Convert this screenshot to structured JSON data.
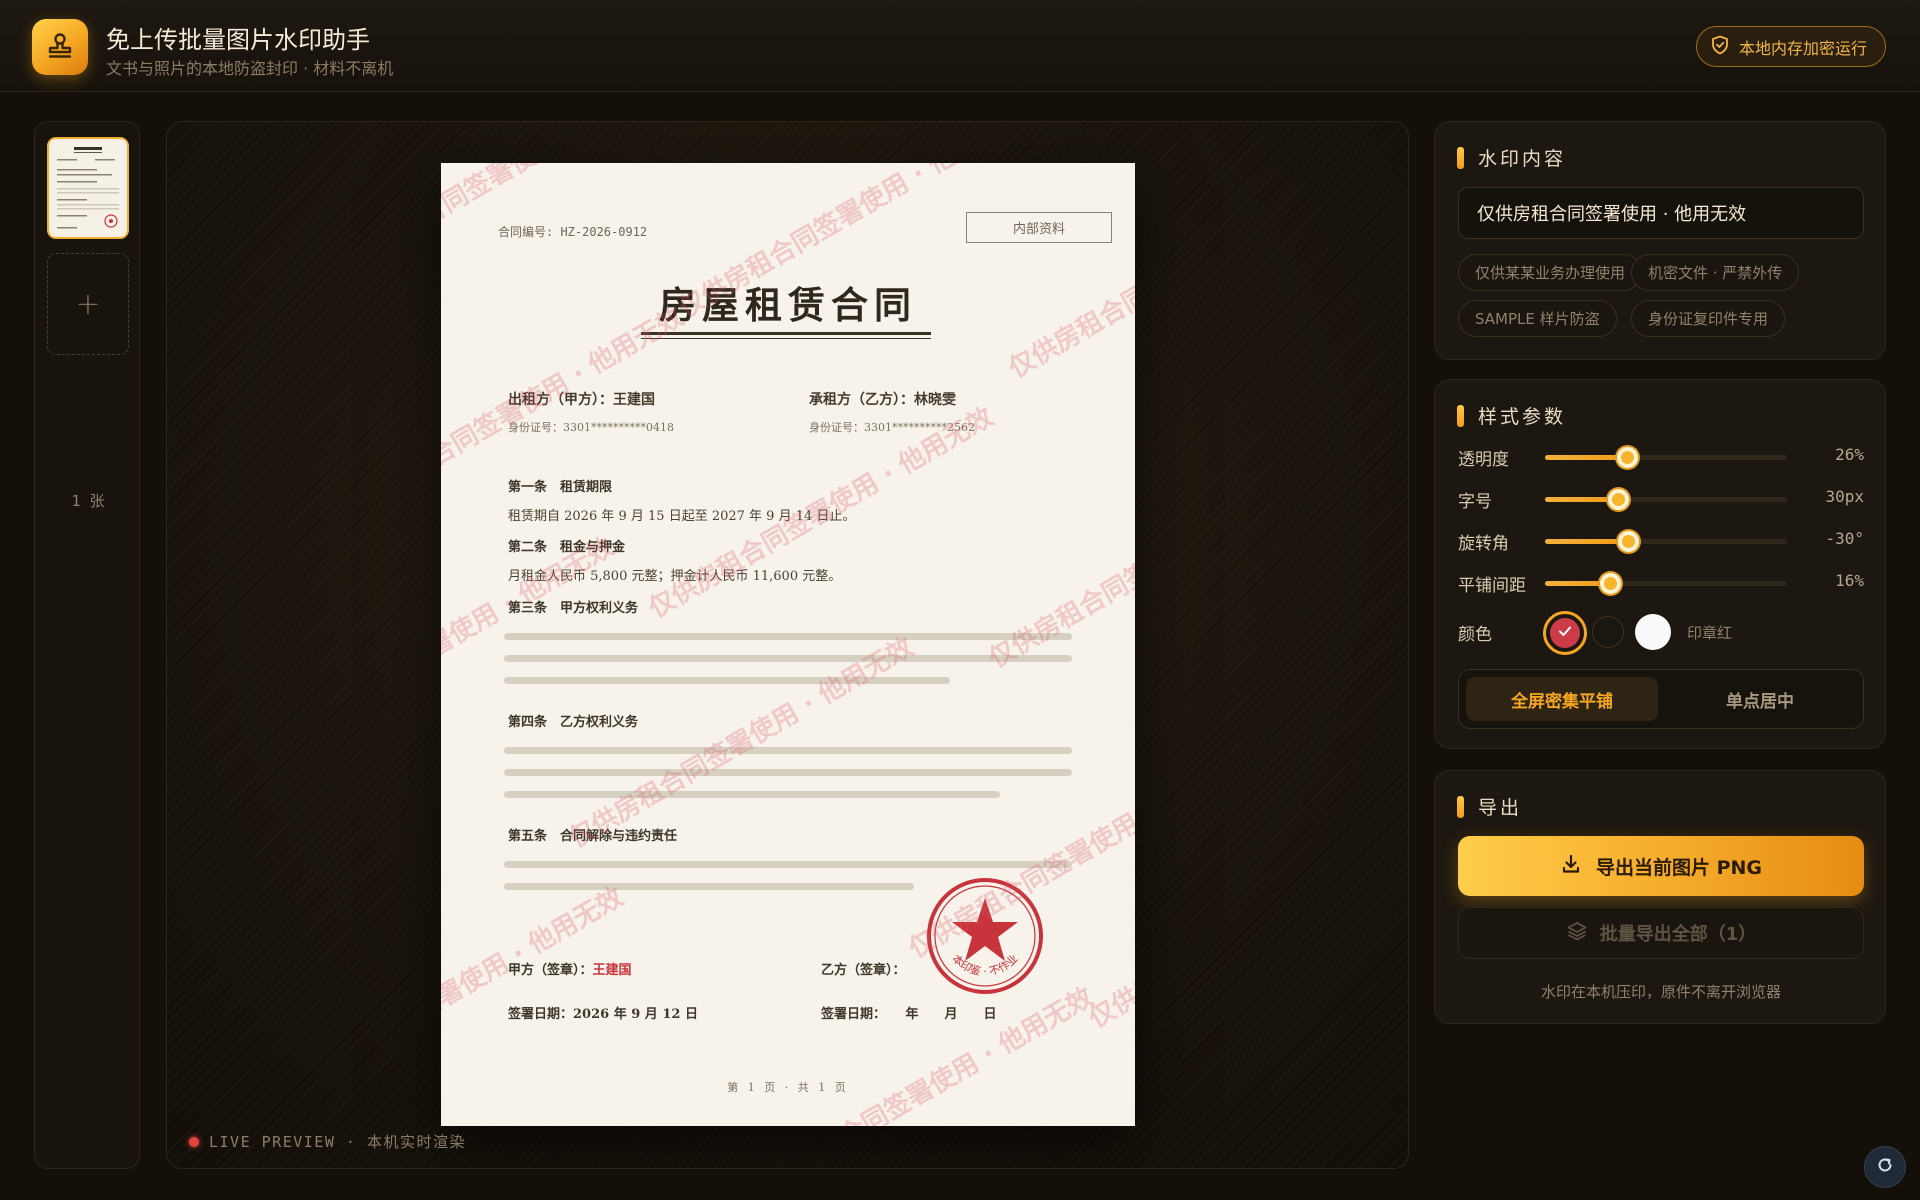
{
  "header": {
    "title": "免上传批量图片水印助手",
    "subtitle": "文书与照片的本地防盗封印 · 材料不离机",
    "badge": "本地内存加密运行"
  },
  "thumbnails": {
    "count_label": "1 张",
    "add_label": "+"
  },
  "preview": {
    "live_label": "LIVE PREVIEW · 本机实时渲染",
    "document": {
      "contract_no": "合同编号: HZ-2026-0912",
      "internal_tag": "内部资料",
      "title": "房屋租赁合同",
      "lessor": "出租方（甲方）：王建国",
      "lessor_id": "身份证号：3301**********0418",
      "lessee": "承租方（乙方）：林晓雯",
      "lessee_id": "身份证号：3301**********2562",
      "art1_title": "第一条　租赁期限",
      "art1_text": "租赁期自 2026 年 9 月 15 日起至 2027 年 9 月 14 日止。",
      "art2_title": "第二条　租金与押金",
      "art2_text": "月租金人民币 5,800 元整；押金计人民币 11,600 元整。",
      "art3_title": "第三条　甲方权利义务",
      "art4_title": "第四条　乙方权利义务",
      "art5_title": "第五条　合同解除与违约责任",
      "sign_a_label": "甲方（签章）：",
      "sign_a_name": "王建国",
      "sign_b_label": "乙方（签章）：",
      "date_a": "签署日期：2026 年 9 月 12 日",
      "date_b": "签署日期：　　年　　月　　日",
      "stamp_text": "本印鉴 · 不作业",
      "page_no": "第 1 页 · 共 1 页",
      "watermark_text": "仅供房租合同签署使用 · 他用无效"
    }
  },
  "content_panel": {
    "title": "水印内容",
    "input_value": "仅供房租合同签署使用 · 他用无效",
    "presets": [
      "仅供某某业务办理使用",
      "机密文件 · 严禁外传",
      "SAMPLE 样片防盗",
      "身份证复印件专用"
    ]
  },
  "style_panel": {
    "title": "样式参数",
    "sliders": [
      {
        "label": "透明度",
        "value": "26%",
        "level": 0.34
      },
      {
        "label": "字号",
        "value": "30px",
        "level": 0.3
      },
      {
        "label": "旋转角",
        "value": "-30°",
        "level": 0.345
      },
      {
        "label": "平铺间距",
        "value": "16%",
        "level": 0.27
      }
    ],
    "color_label": "颜色",
    "color_name": "印章红",
    "colors": {
      "red": "#cc3b48",
      "dark": "#1a1610",
      "white": "#fafafa"
    },
    "modes": [
      "全屏密集平铺",
      "单点居中"
    ],
    "active_mode": "全屏密集平铺"
  },
  "export_panel": {
    "title": "导出",
    "export_button": "导出当前图片 PNG",
    "batch_button": "批量导出全部（1）",
    "note": "水印在本机压印，原件不离开浏览器"
  },
  "colors": {
    "accent": "#f5a623",
    "background": "#141009",
    "watermark": "#d8546a"
  }
}
